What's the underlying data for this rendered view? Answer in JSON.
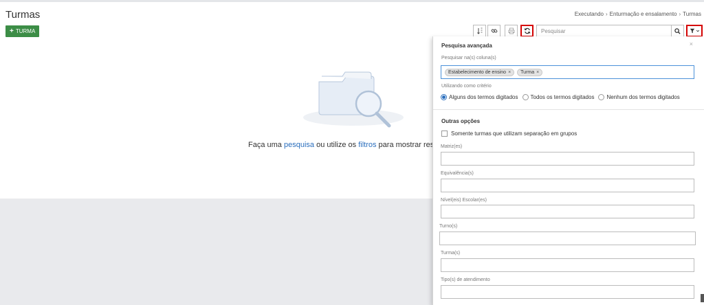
{
  "page": {
    "title": "Turmas"
  },
  "breadcrumb": [
    "Executando",
    "Enturmação e ensalamento",
    "Turmas"
  ],
  "toolbar": {
    "add_label": "TURMA",
    "search_placeholder": "Pesquisar"
  },
  "icons": {
    "sort": "sort-icon",
    "link": "link-icon",
    "print": "print-icon",
    "refresh": "refresh-icon",
    "search": "search-icon",
    "filter": "filter-icon",
    "close": "close-icon"
  },
  "empty_state": {
    "prefix": "Faça uma ",
    "link1": "pesquisa",
    "middle": " ou utilize os ",
    "link2": "filtros",
    "suffix": " para mostrar resu"
  },
  "advanced_search": {
    "title": "Pesquisa avançada",
    "close": "×",
    "columns_label": "Pesquisar na(s) coluna(s)",
    "tags": [
      "Estabelecimento de ensino",
      "Turma"
    ],
    "tag_remove": "×",
    "criteria_label": "Utilizando como critério",
    "criteria_options": [
      "Alguns dos termos digitados",
      "Todos os termos digitados",
      "Nenhum dos termos digitados"
    ],
    "criteria_selected": "Alguns dos termos digitados"
  },
  "other_options": {
    "title": "Outras opções",
    "checkbox_label": "Somente turmas que utilizam separação em grupos",
    "fields": {
      "matriz": "Matriz(es)",
      "equivalencia": "Equivalência(s)",
      "nivel": "Nível(eis) Escolar(es)",
      "turno": "Turno(s)",
      "turma": "Turma(s)",
      "tipo": "Tipo(s) de atendimento"
    }
  },
  "colors": {
    "accent": "#3c8d46",
    "link": "#2a6ebd",
    "highlight": "#d50000",
    "input_focus": "#4a90d9"
  }
}
